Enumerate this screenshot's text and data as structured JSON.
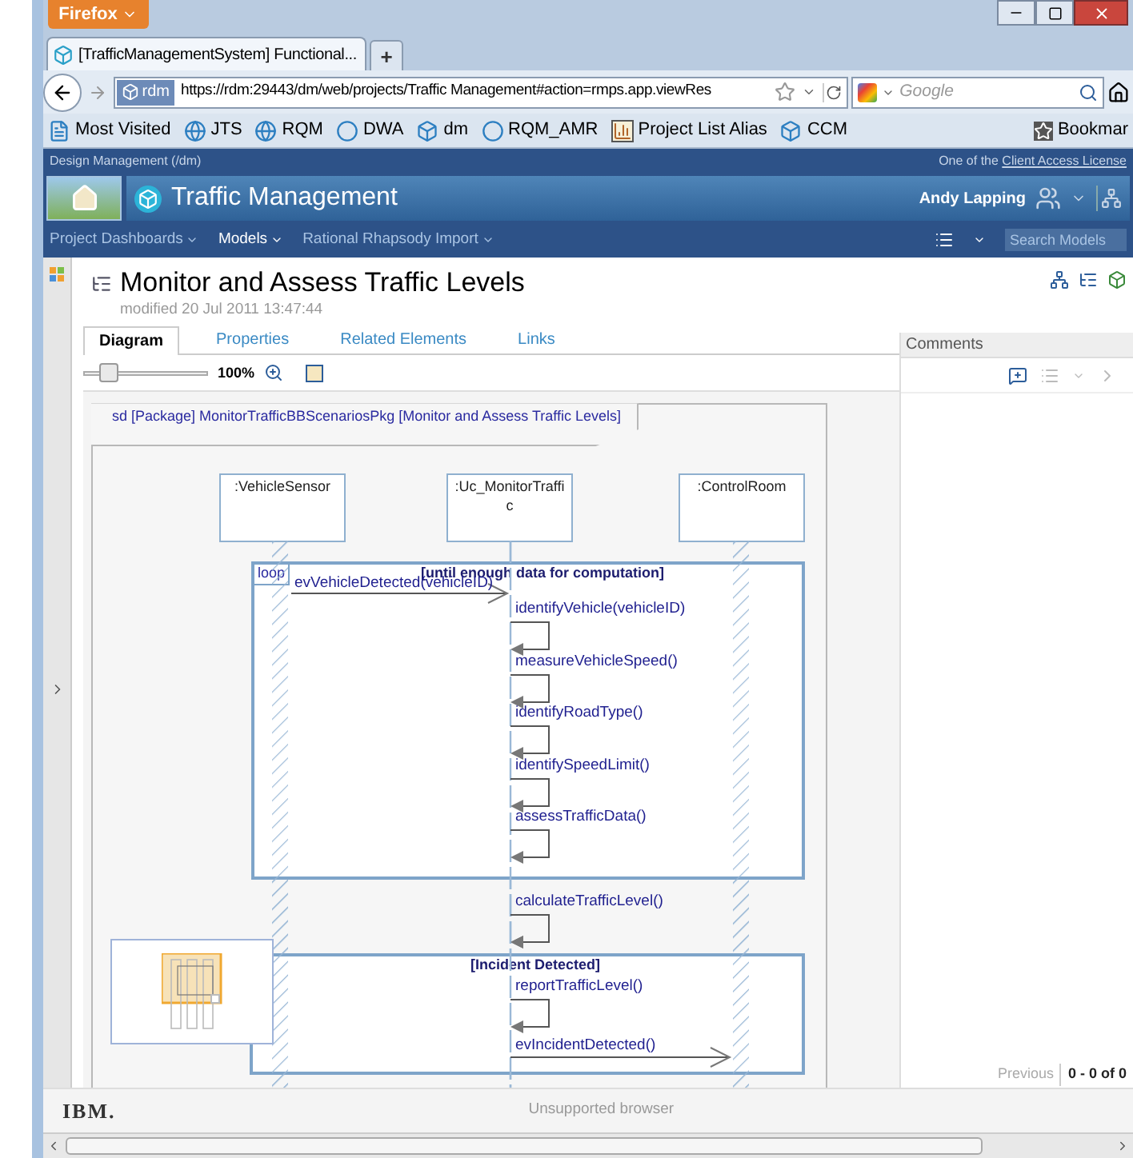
{
  "browser": {
    "menu_button": "Firefox",
    "tab": {
      "title": "[TrafficManagementSystem] Functional...",
      "selected": true
    },
    "new_tab": "+",
    "site_badge": "rdm",
    "url": "https://rdm:29443/dm/web/projects/Traffic Management#action=rmps.app.viewRes",
    "search": {
      "placeholder": "Google"
    },
    "bookmarks": [
      {
        "label": "Most Visited",
        "kind": "page"
      },
      {
        "label": "JTS",
        "kind": "globe"
      },
      {
        "label": "RQM",
        "kind": "globe"
      },
      {
        "label": "DWA",
        "kind": "circle"
      },
      {
        "label": "dm",
        "kind": "cube"
      },
      {
        "label": "RQM_AMR",
        "kind": "circle"
      },
      {
        "label": "Project List Alias",
        "kind": "chart"
      },
      {
        "label": "CCM",
        "kind": "cube"
      }
    ],
    "bookmarks_menu": "Bookmar"
  },
  "app": {
    "product": "Design Management (/dm)",
    "license_prefix": "One of the",
    "license_link": "Client Access License",
    "project": "Traffic Management",
    "user": "Andy Lapping",
    "nav": [
      {
        "label": "Project Dashboards",
        "selected": false
      },
      {
        "label": "Models",
        "selected": true
      },
      {
        "label": "Rational Rhapsody Import",
        "selected": false
      }
    ],
    "search": {
      "placeholder": "Search Models"
    }
  },
  "page": {
    "title": "Monitor and Assess Traffic Levels",
    "modified": "modified 20 Jul 2011 13:47:44",
    "tabs": [
      {
        "label": "Diagram",
        "selected": true
      },
      {
        "label": "Properties",
        "selected": false
      },
      {
        "label": "Related Elements",
        "selected": false
      },
      {
        "label": "Links",
        "selected": false
      }
    ],
    "zoom": {
      "level": 0.2,
      "reading": "100%"
    }
  },
  "diagram": {
    "frame_title": "sd [Package] MonitorTrafficBBScenariosPkg [Monitor and Assess Traffic Levels]",
    "lifelines": [
      {
        "name": ":VehicleSensor",
        "kind": "hatched"
      },
      {
        "name": ":Uc_MonitorTraffi c",
        "kind": "dashed"
      },
      {
        "name": ":ControlRoom",
        "kind": "hatched"
      }
    ],
    "fragments": [
      {
        "operator": "loop",
        "guard": "[until enough data for computation]"
      },
      {
        "guard": "[Incident Detected]"
      }
    ],
    "messages": [
      {
        "label": "evVehicleDetected(vehicleID)",
        "kind": "call"
      },
      {
        "label": "identifyVehicle(vehicleID)",
        "kind": "self"
      },
      {
        "label": "measureVehicleSpeed()",
        "kind": "self"
      },
      {
        "label": "identifyRoadType()",
        "kind": "self"
      },
      {
        "label": "identifySpeedLimit()",
        "kind": "self"
      },
      {
        "label": "assessTrafficData()",
        "kind": "self"
      },
      {
        "label": "calculateTrafficLevel()",
        "kind": "self"
      },
      {
        "label": "reportTrafficLevel()",
        "kind": "self"
      },
      {
        "label": "evIncidentDetected()",
        "kind": "send"
      }
    ]
  },
  "comments": {
    "title": "Comments",
    "previous": "Previous",
    "count": "0 - 0 of 0"
  },
  "footer": {
    "logo": "IBM.",
    "notice": "Unsupported browser"
  }
}
